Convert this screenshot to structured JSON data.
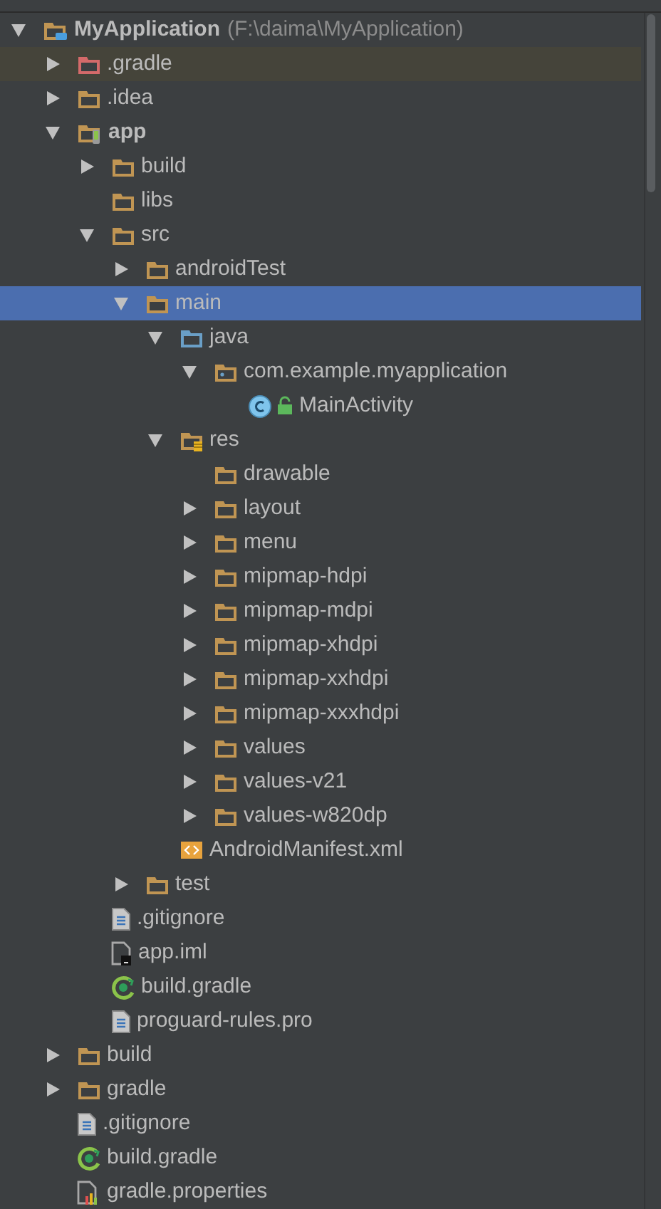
{
  "tree": [
    {
      "label": "MyApplication",
      "path": "(F:\\daima\\MyApplication)",
      "kind": "module",
      "expanded": true,
      "selected": false,
      "children": [
        {
          "label": ".gradle",
          "kind": "excluded-folder",
          "expanded": false,
          "selected": false
        },
        {
          "label": ".idea",
          "kind": "folder",
          "expanded": false,
          "selected": false
        },
        {
          "label": "app",
          "kind": "app-module",
          "expanded": true,
          "selected": false,
          "children": [
            {
              "label": "build",
              "kind": "folder",
              "expanded": false,
              "selected": false
            },
            {
              "label": "libs",
              "kind": "folder",
              "selected": false
            },
            {
              "label": "src",
              "kind": "folder",
              "expanded": true,
              "selected": false,
              "children": [
                {
                  "label": "androidTest",
                  "kind": "folder",
                  "expanded": false,
                  "selected": false
                },
                {
                  "label": "main",
                  "kind": "folder",
                  "expanded": true,
                  "selected": true,
                  "children": [
                    {
                      "label": "java",
                      "kind": "source-folder",
                      "expanded": true,
                      "selected": false,
                      "children": [
                        {
                          "label": "com.example.myapplication",
                          "kind": "package",
                          "expanded": true,
                          "selected": false,
                          "children": [
                            {
                              "label": "MainActivity",
                              "kind": "class",
                              "selected": false
                            }
                          ]
                        }
                      ]
                    },
                    {
                      "label": "res",
                      "kind": "resource-folder",
                      "expanded": true,
                      "selected": false,
                      "children": [
                        {
                          "label": "drawable",
                          "kind": "folder",
                          "selected": false
                        },
                        {
                          "label": "layout",
                          "kind": "folder",
                          "expanded": false,
                          "selected": false
                        },
                        {
                          "label": "menu",
                          "kind": "folder",
                          "expanded": false,
                          "selected": false
                        },
                        {
                          "label": "mipmap-hdpi",
                          "kind": "folder",
                          "expanded": false,
                          "selected": false
                        },
                        {
                          "label": "mipmap-mdpi",
                          "kind": "folder",
                          "expanded": false,
                          "selected": false
                        },
                        {
                          "label": "mipmap-xhdpi",
                          "kind": "folder",
                          "expanded": false,
                          "selected": false
                        },
                        {
                          "label": "mipmap-xxhdpi",
                          "kind": "folder",
                          "expanded": false,
                          "selected": false
                        },
                        {
                          "label": "mipmap-xxxhdpi",
                          "kind": "folder",
                          "expanded": false,
                          "selected": false
                        },
                        {
                          "label": "values",
                          "kind": "folder",
                          "expanded": false,
                          "selected": false
                        },
                        {
                          "label": "values-v21",
                          "kind": "folder",
                          "expanded": false,
                          "selected": false
                        },
                        {
                          "label": "values-w820dp",
                          "kind": "folder",
                          "expanded": false,
                          "selected": false
                        }
                      ]
                    },
                    {
                      "label": "AndroidManifest.xml",
                      "kind": "manifest",
                      "selected": false
                    }
                  ]
                },
                {
                  "label": "test",
                  "kind": "folder",
                  "expanded": false,
                  "selected": false
                }
              ]
            },
            {
              "label": ".gitignore",
              "kind": "text-file",
              "selected": false
            },
            {
              "label": "app.iml",
              "kind": "iml-file",
              "selected": false
            },
            {
              "label": "build.gradle",
              "kind": "gradle-file",
              "selected": false
            },
            {
              "label": "proguard-rules.pro",
              "kind": "text-file",
              "selected": false
            }
          ]
        },
        {
          "label": "build",
          "kind": "folder",
          "expanded": false,
          "selected": false
        },
        {
          "label": "gradle",
          "kind": "folder",
          "expanded": false,
          "selected": false
        },
        {
          "label": ".gitignore",
          "kind": "text-file",
          "selected": false
        },
        {
          "label": "build.gradle",
          "kind": "gradle-file",
          "selected": false
        },
        {
          "label": "gradle.properties",
          "kind": "properties-file",
          "selected": false
        }
      ]
    }
  ]
}
